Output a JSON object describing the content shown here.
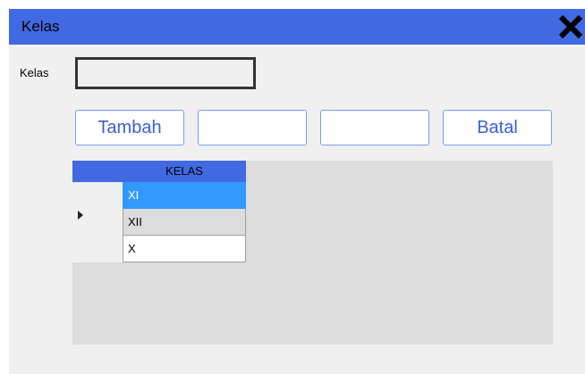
{
  "window": {
    "title": "Kelas",
    "titlebar_color": "#4169e1",
    "close_icon": "close-x-icon"
  },
  "form": {
    "label": "Kelas",
    "input_value": ""
  },
  "buttons": [
    {
      "label": "Tambah"
    },
    {
      "label": ""
    },
    {
      "label": ""
    },
    {
      "label": "Batal"
    }
  ],
  "grid": {
    "column_header": "KELAS",
    "rows": [
      "XI",
      "XII",
      "X"
    ],
    "selected_row": 0,
    "selection_color": "#3399ff"
  }
}
